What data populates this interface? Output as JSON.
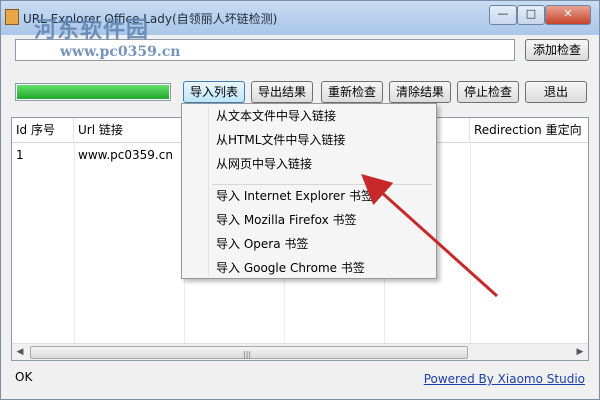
{
  "window": {
    "title": "URL Explorer Office Lady(自领丽人坏链检测)",
    "minimize_glyph": "—",
    "maximize_glyph": "□",
    "close_glyph": "✕"
  },
  "watermark": {
    "site_name": "河东软件园",
    "url": "www.pc0359.cn"
  },
  "toolbar": {
    "url_input_value": "",
    "add_check": "添加检查",
    "import_list": "导入列表",
    "export_results": "导出结果",
    "recheck": "重新检查",
    "clear_results": "清除结果",
    "stop_check": "停止检查",
    "exit": "退出",
    "progress_percent": 100
  },
  "table": {
    "columns": [
      "Id 序号",
      "Url 链接",
      "Redirection 重定向"
    ],
    "rows": [
      {
        "id": "1",
        "url": "www.pc0359.cn",
        "redirection": ""
      }
    ]
  },
  "import_menu": {
    "items": [
      "从文本文件中导入链接",
      "从HTML文件中导入链接",
      "从网页中导入链接",
      "导入 Internet Explorer 书签",
      "导入 Mozilla Firefox 书签",
      "导入 Opera 书签",
      "导入 Google Chrome 书签"
    ]
  },
  "status": {
    "text": "OK",
    "powered_by": "Powered By Xiaomo Studio"
  },
  "colors": {
    "progress": "#1fa82c",
    "annotation_arrow": "#c8282a",
    "link": "#1a3fa8"
  }
}
